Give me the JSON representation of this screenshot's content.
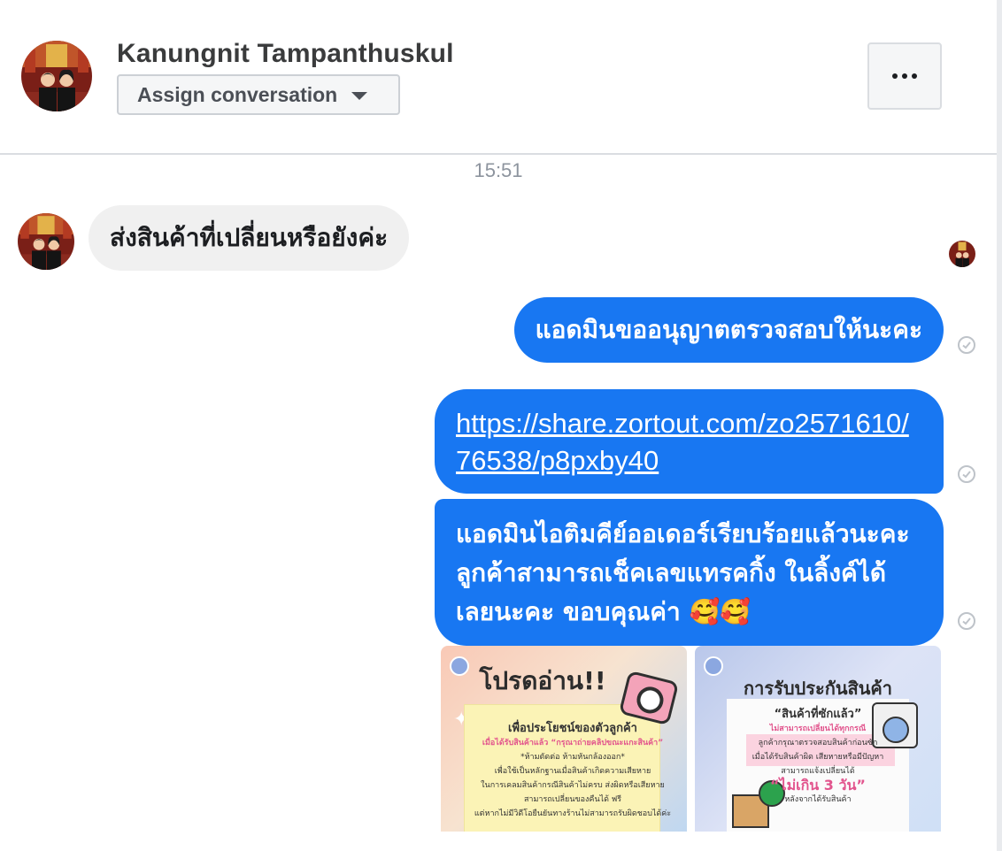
{
  "header": {
    "contact_name": "Kanungnit Tampanthuskul",
    "assign_label": "Assign conversation",
    "more_icon": "more-horizontal-icon"
  },
  "thread": {
    "timestamp": "15:51",
    "messages": [
      {
        "direction": "incoming",
        "text": "ส่งสินค้าที่เปลี่ยนหรือยังค่ะ"
      },
      {
        "direction": "outgoing",
        "text": "แอดมินขออนุญาตตรวจสอบให้นะคะ",
        "status": "sent"
      },
      {
        "direction": "outgoing",
        "text": "https://share.zortout.com/zo2571610/76538/p8pxby40",
        "type": "link",
        "status": "sent"
      },
      {
        "direction": "outgoing",
        "text": "แอดมินไอติมคีย์ออเดอร์เรียบร้อยแล้วนะคะ ลูกค้าสามารถเช็คเลขแทรคกิ้ง ในลิ้งค์ได้เลยนะคะ ขอบคุณค่า 🥰🥰",
        "status": "sent"
      }
    ],
    "attachments": [
      {
        "title": "โปรดอ่าน!!",
        "lines": [
          "เพื่อประโยชน์ของตัวลูกค้า",
          "เมื่อได้รับสินค้าแล้ว “กรุณาถ่ายคลิปขณะแกะสินค้า”",
          "*ห้ามตัดต่อ ห้ามหันกล้องออก*",
          "เพื่อใช้เป็นหลักฐานเมื่อสินค้าเกิดความเสียหาย",
          "ในการเคลมสินค้ากรณีสินค้าไม่ครบ ส่งผิดหรือเสียหาย",
          "สามารถเปลี่ยนของคืนได้ ฟรี",
          "แต่หากไม่มีวิดีโอยืนยันทางร้านไม่สามารถรับผิดชอบได้ค่ะ"
        ]
      },
      {
        "title": "การรับประกันสินค้า",
        "lines": [
          "“สินค้าที่ซักแล้ว”",
          "ไม่สามารถเปลี่ยนได้ทุกกรณี",
          "ลูกค้ากรุณาตรวจสอบสินค้าก่อนซัก",
          "เมื่อได้รับสินค้าผิด เสียหายหรือมีปัญหา",
          "สามารถแจ้งเปลี่ยนได้",
          "“ไม่เกิน 3 วัน”",
          "หลังจากได้รับสินค้า"
        ]
      }
    ]
  },
  "colors": {
    "outgoing_bubble": "#1877f2",
    "incoming_bubble": "#f0f0f0"
  }
}
